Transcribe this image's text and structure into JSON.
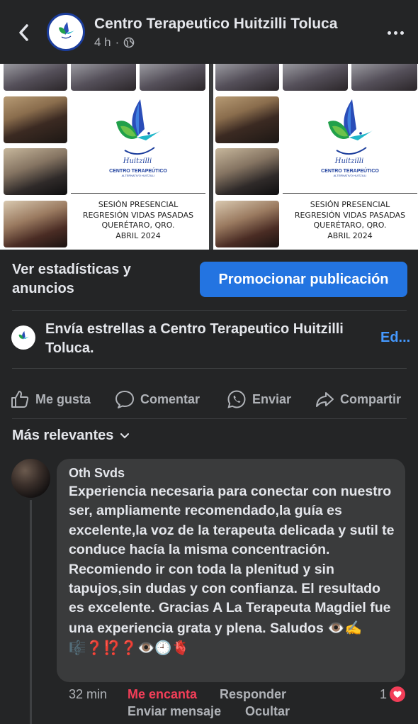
{
  "header": {
    "page_name": "Centro Terapeutico Huitzilli Toluca",
    "time": "4 h",
    "privacy_icon": "globe-icon"
  },
  "post_image": {
    "logo_caption": "CENTRO TERAPEÚTICO",
    "logo_sub": "ALTERNATIVO HUITZILLI",
    "logo_script": "Huitzilli",
    "lines": [
      "SESIÓN PRESENCIAL",
      "REGRESIÓN VIDAS PASADAS",
      "QUERÉTARO, QRO.",
      "ABRIL 2024"
    ]
  },
  "stats": {
    "label": "Ver estadísticas y anuncios",
    "promote_label": "Promocionar publicación"
  },
  "stars": {
    "text": "Envía estrellas a Centro Terapeutico Huitzilli Toluca.",
    "edit_label": "Ed..."
  },
  "actions": {
    "like": "Me gusta",
    "comment": "Comentar",
    "send": "Enviar",
    "share": "Compartir"
  },
  "sort": {
    "label": "Más relevantes"
  },
  "comment": {
    "author": "Oth Svds",
    "text": "Experiencia necesaria para conectar con nuestro ser, ampliamente recomendado,la guía es excelente,la voz de la terapeuta delicada y sutil te conduce hacía la misma concentración. Recomiendo ir con toda la plenitud y sin tapujos,sin dudas y con confianza. El resultado es excelente. Gracias A La Terapeuta Magdiel fue una experiencia grata y plena. Saludos",
    "emojis": "👁️✍️🎼❓⁉️❓👁️🕘🫀",
    "time": "32 min",
    "love_label": "Me encanta",
    "reply_label": "Responder",
    "message_label": "Enviar mensaje",
    "hide_label": "Ocultar",
    "reaction_count": "1"
  },
  "colors": {
    "background": "#242526",
    "bubble": "#3a3b3c",
    "primary": "#2374e1",
    "link": "#4599ff",
    "love": "#f33e58"
  }
}
